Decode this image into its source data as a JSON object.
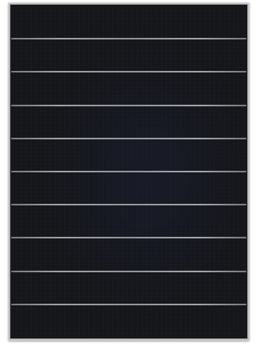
{
  "image": {
    "subject": "solar-panel",
    "colors": {
      "background": "#ffffff",
      "frame": "#c9c9c9",
      "cells": "#15161a",
      "busbar": "#b0b0b0"
    },
    "cell_rows": 10
  }
}
